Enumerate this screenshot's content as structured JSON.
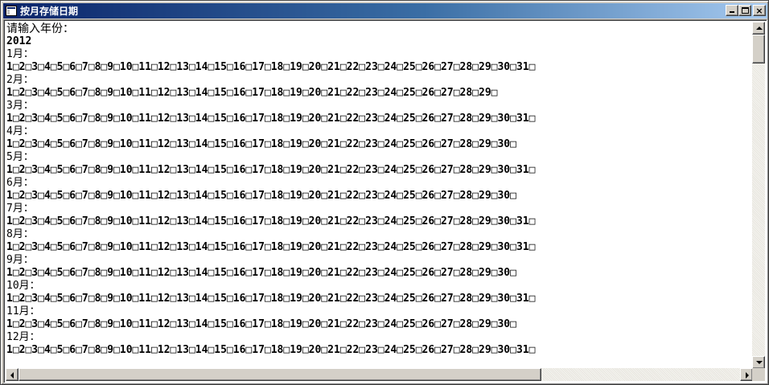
{
  "window": {
    "title": "按月存储日期",
    "buttons": {
      "minimize": "minimize",
      "maximize": "maximize",
      "close": "×"
    }
  },
  "console": {
    "prompt": "请输入年份：",
    "year": "2012",
    "months": [
      {
        "label": "1月：",
        "days": "1□2□3□4□5□6□7□8□9□10□11□12□13□14□15□16□17□18□19□20□21□22□23□24□25□26□27□28□29□30□31□"
      },
      {
        "label": "2月：",
        "days": "1□2□3□4□5□6□7□8□9□10□11□12□13□14□15□16□17□18□19□20□21□22□23□24□25□26□27□28□29□"
      },
      {
        "label": "3月：",
        "days": "1□2□3□4□5□6□7□8□9□10□11□12□13□14□15□16□17□18□19□20□21□22□23□24□25□26□27□28□29□30□31□"
      },
      {
        "label": "4月：",
        "days": "1□2□3□4□5□6□7□8□9□10□11□12□13□14□15□16□17□18□19□20□21□22□23□24□25□26□27□28□29□30□"
      },
      {
        "label": "5月：",
        "days": "1□2□3□4□5□6□7□8□9□10□11□12□13□14□15□16□17□18□19□20□21□22□23□24□25□26□27□28□29□30□31□"
      },
      {
        "label": "6月：",
        "days": "1□2□3□4□5□6□7□8□9□10□11□12□13□14□15□16□17□18□19□20□21□22□23□24□25□26□27□28□29□30□"
      },
      {
        "label": "7月：",
        "days": "1□2□3□4□5□6□7□8□9□10□11□12□13□14□15□16□17□18□19□20□21□22□23□24□25□26□27□28□29□30□31□"
      },
      {
        "label": "8月：",
        "days": "1□2□3□4□5□6□7□8□9□10□11□12□13□14□15□16□17□18□19□20□21□22□23□24□25□26□27□28□29□30□31□"
      },
      {
        "label": "9月：",
        "days": "1□2□3□4□5□6□7□8□9□10□11□12□13□14□15□16□17□18□19□20□21□22□23□24□25□26□27□28□29□30□"
      },
      {
        "label": "10月：",
        "days": "1□2□3□4□5□6□7□8□9□10□11□12□13□14□15□16□17□18□19□20□21□22□23□24□25□26□27□28□29□30□31□"
      },
      {
        "label": "11月：",
        "days": "1□2□3□4□5□6□7□8□9□10□11□12□13□14□15□16□17□18□19□20□21□22□23□24□25□26□27□28□29□30□"
      },
      {
        "label": "12月：",
        "days": "1□2□3□4□5□6□7□8□9□10□11□12□13□14□15□16□17□18□19□20□21□22□23□24□25□26□27□28□29□30□31□"
      }
    ]
  },
  "icons": {
    "app": "console-app-icon",
    "scroll_up": "arrow-up-icon",
    "scroll_down": "arrow-down-icon",
    "scroll_left": "arrow-left-icon",
    "scroll_right": "arrow-right-icon"
  },
  "colors": {
    "titlebar_start": "#0a246a",
    "titlebar_end": "#a6caf0",
    "console_bg": "#ffffff",
    "console_text": "#000000",
    "chrome": "#d4d0c8"
  }
}
